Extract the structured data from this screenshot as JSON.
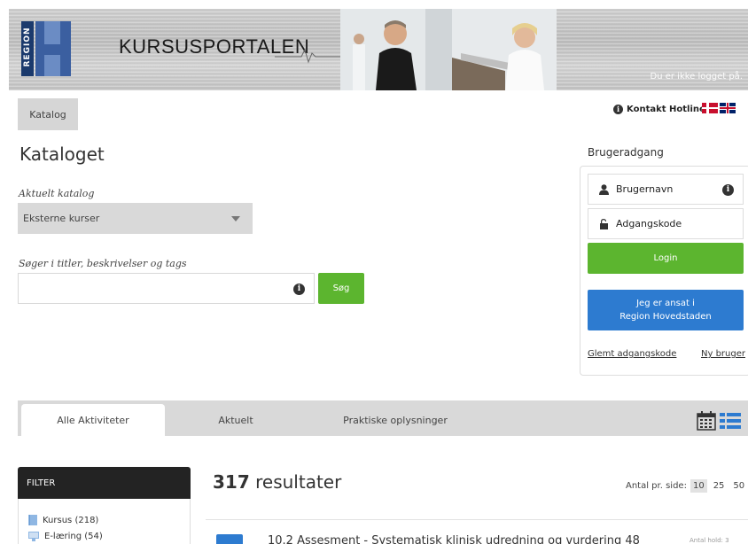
{
  "header": {
    "logo_text": "REGION",
    "portal_title": "KURSUSPORTALEN",
    "login_status": "Du er ikke logget på."
  },
  "nav": {
    "catalog_tab": "Katalog",
    "hotline": "Kontakt Hotline"
  },
  "catalog": {
    "title": "Kataloget",
    "current_catalog_label": "Aktuelt katalog",
    "current_catalog_value": "Eksterne kurser",
    "search_label": "Søger i titler, beskrivelser og tags",
    "search_value": "",
    "search_button": "Søg"
  },
  "login": {
    "heading": "Brugeradgang",
    "username_placeholder": "Brugernavn",
    "password_placeholder": "Adgangskode",
    "login_button": "Login",
    "employee_button_line1": "Jeg er ansat i",
    "employee_button_line2": "Region Hovedstaden",
    "forgot_password": "Glemt adgangskode",
    "new_user": "Ny bruger"
  },
  "tabs": [
    {
      "label": "Alle Aktiviteter",
      "active": true
    },
    {
      "label": "Aktuelt",
      "active": false
    },
    {
      "label": "Praktiske oplysninger",
      "active": false
    }
  ],
  "filter": {
    "heading": "FILTER",
    "items": [
      {
        "label": "Kursus (218)",
        "icon": "book-icon"
      },
      {
        "label": "E-læring (54)",
        "icon": "computer-icon"
      }
    ]
  },
  "results": {
    "count": "317",
    "count_label": "resultater",
    "per_page_label": "Antal pr. side:",
    "per_page_options": [
      "10",
      "25",
      "50"
    ],
    "per_page_selected": "10",
    "first_result_title": "10.2 Assesment - Systematisk klinisk udredning og vurdering 48",
    "first_result_meta": "Antal hold: 3"
  },
  "colors": {
    "green": "#5cb52f",
    "blue": "#2d7bd0",
    "dark": "#232323"
  }
}
